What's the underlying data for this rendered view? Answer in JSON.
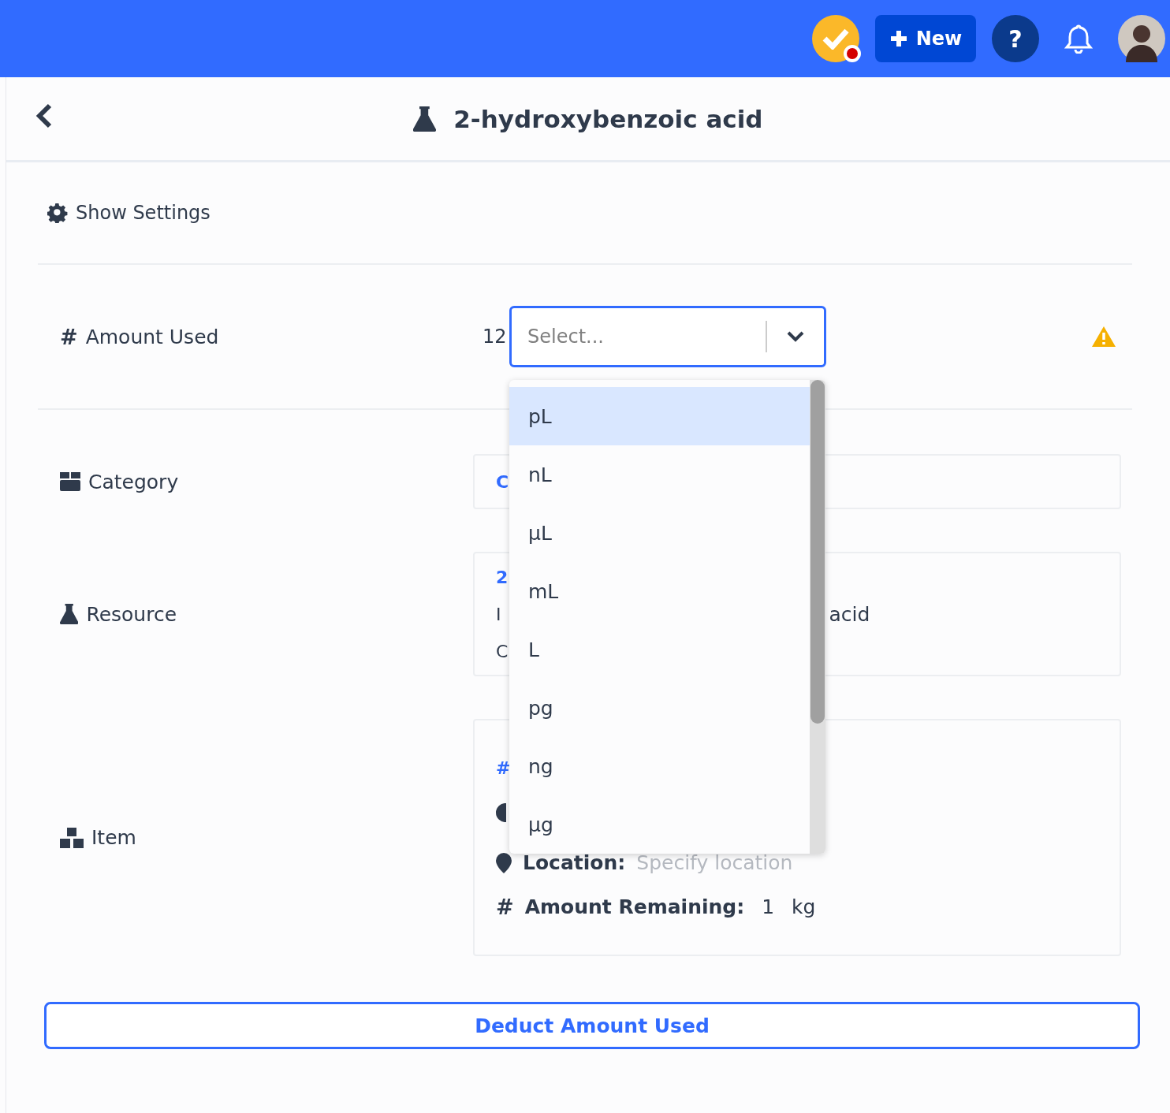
{
  "top_bar": {
    "task_alert": true,
    "new_button": "New",
    "help_button": "?"
  },
  "header": {
    "title": "2-hydroxybenzoic acid"
  },
  "settings_toggle": {
    "label": "Show Settings"
  },
  "amount_used": {
    "symbol": "#",
    "label": "Amount Used",
    "value": "12",
    "unit_select": {
      "placeholder": "Select...",
      "open": true
    },
    "warning": true
  },
  "category": {
    "label": "Category",
    "fragment": "C"
  },
  "resource": {
    "label": "Resource",
    "lines": [
      {
        "text": "2",
        "link": true
      },
      {
        "text": "I",
        "link": false,
        "tail": "acid"
      },
      {
        "text": "C",
        "link": false
      }
    ]
  },
  "item": {
    "label": "Item",
    "link_fragment": "#",
    "location_label": "Location:",
    "location_placeholder": "Specify location",
    "remaining_symbol": "#",
    "remaining_label": "Amount Remaining:",
    "remaining_value": "1",
    "remaining_unit": "kg"
  },
  "unit_options": [
    {
      "label": "pL",
      "selected": true
    },
    {
      "label": "nL",
      "selected": false
    },
    {
      "label": "µL",
      "selected": false
    },
    {
      "label": "mL",
      "selected": false
    },
    {
      "label": "L",
      "selected": false
    },
    {
      "label": "pg",
      "selected": false
    },
    {
      "label": "ng",
      "selected": false
    },
    {
      "label": "µg",
      "selected": false
    }
  ],
  "deduct_button": "Deduct Amount Used"
}
